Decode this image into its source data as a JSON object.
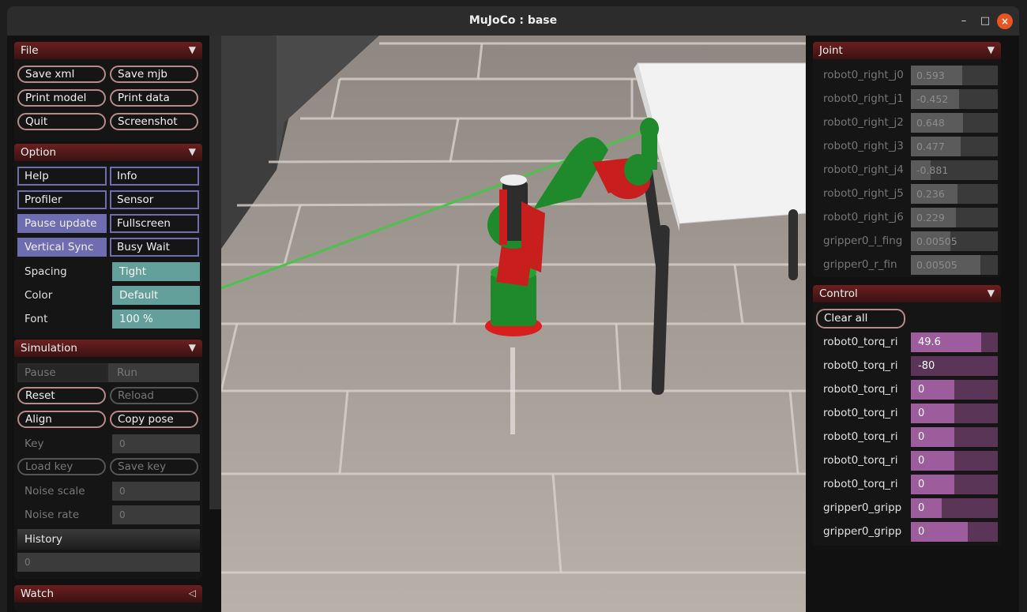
{
  "window": {
    "title": "MuJoCo : base",
    "minimize": "–",
    "maximize": "□",
    "close": "×"
  },
  "file": {
    "title": "File",
    "buttons": [
      "Save xml",
      "Save mjb",
      "Print model",
      "Print data",
      "Quit",
      "Screenshot"
    ]
  },
  "option": {
    "title": "Option",
    "buttons": [
      "Help",
      "Info",
      "Profiler",
      "Sensor",
      "Pause update",
      "Fullscreen",
      "Vertical Sync",
      "Busy Wait"
    ],
    "spacing_label": "Spacing",
    "spacing_value": "Tight",
    "color_label": "Color",
    "color_value": "Default",
    "font_label": "Font",
    "font_value": "100 %"
  },
  "simulation": {
    "title": "Simulation",
    "pause": "Pause",
    "run": "Run",
    "reset": "Reset",
    "reload": "Reload",
    "align": "Align",
    "copy_pose": "Copy pose",
    "key_label": "Key",
    "key_value": "0",
    "load_key": "Load key",
    "save_key": "Save key",
    "noise_scale_label": "Noise scale",
    "noise_scale_value": "0",
    "noise_rate_label": "Noise rate",
    "noise_rate_value": "0",
    "history_label": "History",
    "history_value": "0"
  },
  "watch": {
    "title": "Watch"
  },
  "joint": {
    "title": "Joint",
    "rows": [
      {
        "label": "robot0_right_j0",
        "value": "0.593",
        "fill": 0.59
      },
      {
        "label": "robot0_right_j1",
        "value": "-0.452",
        "fill": 0.55
      },
      {
        "label": "robot0_right_j2",
        "value": "0.648",
        "fill": 0.6
      },
      {
        "label": "robot0_right_j3",
        "value": "0.477",
        "fill": 0.57
      },
      {
        "label": "robot0_right_j4",
        "value": "-0.881",
        "fill": 0.23
      },
      {
        "label": "robot0_right_j5",
        "value": "0.236",
        "fill": 0.54
      },
      {
        "label": "robot0_right_j6",
        "value": "0.229",
        "fill": 0.52
      },
      {
        "label": "gripper0_l_fing",
        "value": "0.00505",
        "fill": 0.45
      },
      {
        "label": "gripper0_r_fin",
        "value": "0.00505",
        "fill": 0.8
      }
    ]
  },
  "control": {
    "title": "Control",
    "clear_all": "Clear all",
    "rows": [
      {
        "label": "robot0_torq_ri",
        "value": "49.6",
        "fill": 0.81
      },
      {
        "label": "robot0_torq_ri",
        "value": "-80",
        "fill": 0.0
      },
      {
        "label": "robot0_torq_ri",
        "value": "0",
        "fill": 0.5
      },
      {
        "label": "robot0_torq_ri",
        "value": "0",
        "fill": 0.5
      },
      {
        "label": "robot0_torq_ri",
        "value": "0",
        "fill": 0.5
      },
      {
        "label": "robot0_torq_ri",
        "value": "0",
        "fill": 0.5
      },
      {
        "label": "robot0_torq_ri",
        "value": "0",
        "fill": 0.5
      },
      {
        "label": "gripper0_gripp",
        "value": "0",
        "fill": 0.35
      },
      {
        "label": "gripper0_gripp",
        "value": "0",
        "fill": 0.65
      }
    ]
  },
  "colors": {
    "panel_header": "#6b1f1f",
    "toggle_on": "#6f6db2",
    "select": "#63a09c",
    "control_fill": "#9d5c9c",
    "robot_green": "#1d8a2a",
    "robot_red": "#d42020"
  }
}
